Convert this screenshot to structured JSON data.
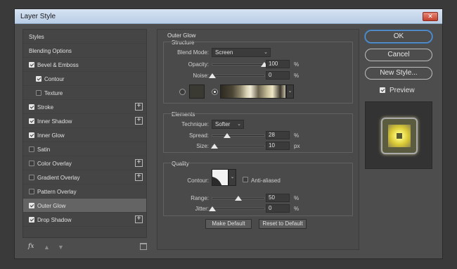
{
  "window": {
    "title": "Layer Style",
    "close_glyph": "✕"
  },
  "styles_list": [
    {
      "label": "Styles",
      "checkbox": null,
      "plus": false,
      "indent": false,
      "active": false
    },
    {
      "label": "Blending Options",
      "checkbox": null,
      "plus": false,
      "indent": false,
      "active": false
    },
    {
      "label": "Bevel & Emboss",
      "checkbox": true,
      "plus": false,
      "indent": false,
      "active": false
    },
    {
      "label": "Contour",
      "checkbox": true,
      "plus": false,
      "indent": true,
      "active": false
    },
    {
      "label": "Texture",
      "checkbox": false,
      "plus": false,
      "indent": true,
      "active": false
    },
    {
      "label": "Stroke",
      "checkbox": true,
      "plus": true,
      "indent": false,
      "active": false
    },
    {
      "label": "Inner Shadow",
      "checkbox": true,
      "plus": true,
      "indent": false,
      "active": false
    },
    {
      "label": "Inner Glow",
      "checkbox": true,
      "plus": false,
      "indent": false,
      "active": false
    },
    {
      "label": "Satin",
      "checkbox": false,
      "plus": false,
      "indent": false,
      "active": false
    },
    {
      "label": "Color Overlay",
      "checkbox": false,
      "plus": true,
      "indent": false,
      "active": false
    },
    {
      "label": "Gradient Overlay",
      "checkbox": false,
      "plus": true,
      "indent": false,
      "active": false
    },
    {
      "label": "Pattern Overlay",
      "checkbox": false,
      "plus": false,
      "indent": false,
      "active": false
    },
    {
      "label": "Outer Glow",
      "checkbox": true,
      "plus": false,
      "indent": false,
      "active": true
    },
    {
      "label": "Drop Shadow",
      "checkbox": true,
      "plus": true,
      "indent": false,
      "active": false
    }
  ],
  "bottom_tools": {
    "fx_label": "fx",
    "up_icon": "▲",
    "down_icon": "▼"
  },
  "outer_glow": {
    "title": "Outer Glow",
    "structure": {
      "title": "Structure",
      "blend_mode_label": "Blend Mode:",
      "blend_mode_value": "Screen",
      "opacity_label": "Opacity:",
      "opacity_value": "100",
      "opacity_fraction": 1.0,
      "noise_label": "Noise:",
      "noise_value": "0",
      "noise_fraction": 0.0,
      "percent": "%"
    },
    "elements": {
      "title": "Elements",
      "technique_label": "Technique:",
      "technique_value": "Softer",
      "spread_label": "Spread:",
      "spread_value": "28",
      "spread_fraction": 0.28,
      "size_label": "Size:",
      "size_value": "10",
      "size_fraction": 0.04,
      "percent": "%",
      "px": "px"
    },
    "quality": {
      "title": "Quality",
      "contour_label": "Contour:",
      "anti_aliased_label": "Anti-aliased",
      "range_label": "Range:",
      "range_value": "50",
      "range_fraction": 0.5,
      "jitter_label": "Jitter:",
      "jitter_value": "0",
      "jitter_fraction": 0.0,
      "percent": "%"
    },
    "make_default": "Make Default",
    "reset_default": "Reset to Default"
  },
  "right": {
    "ok": "OK",
    "cancel": "Cancel",
    "new_style": "New Style...",
    "preview_label": "Preview",
    "preview_checked": true
  },
  "colors": {
    "accent": "#3b74b4",
    "panel_bg": "#4d4d4d",
    "glow": "#f5ee6c"
  }
}
